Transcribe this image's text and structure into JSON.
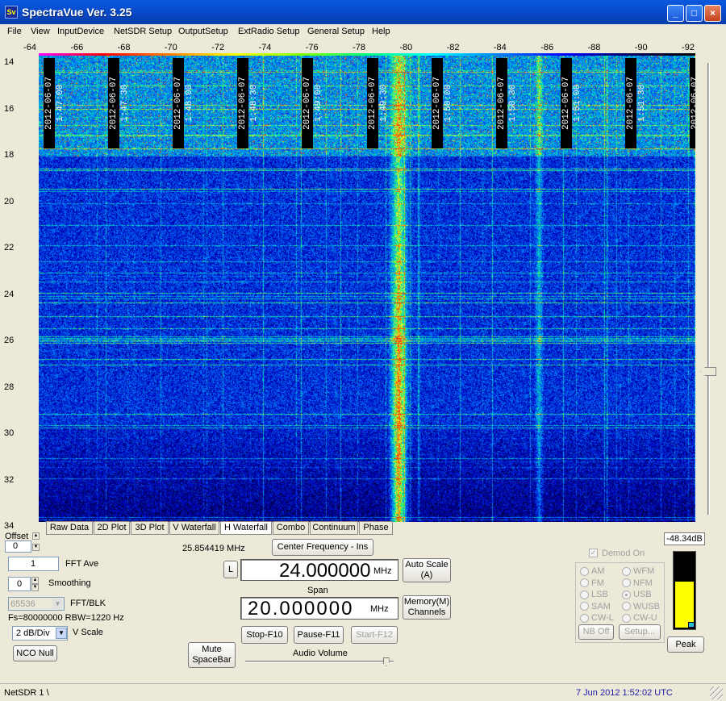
{
  "window": {
    "icon_text": "Sv",
    "title": "SpectraVue Ver. 3.25",
    "controls": {
      "minimize": "_",
      "maximize": "□",
      "close": "×"
    }
  },
  "menu": [
    "File",
    "View",
    "InputDevice",
    "NetSDR Setup",
    "OutputSetup",
    "ExtRadio Setup",
    "General Setup",
    "Help"
  ],
  "x_scale": [
    "-64",
    "-66",
    "-68",
    "-70",
    "-72",
    "-74",
    "-76",
    "-78",
    "-80",
    "-82",
    "-84",
    "-86",
    "-88",
    "-90",
    "-92"
  ],
  "y_scale": [
    "14",
    "16",
    "18",
    "20",
    "22",
    "24",
    "26",
    "28",
    "30",
    "32",
    "34"
  ],
  "waterfall": {
    "timestamps": [
      "2012-06-07 1:47:00",
      "2012-06-07 1:47:30",
      "2012-06-07 1:48:00",
      "2012-06-07 1:48:30",
      "2012-06-07 1:49:00",
      "2012-06-07 1:49:30",
      "2012-06-07 1:50:00",
      "2012-06-07 1:50:30",
      "2012-06-07 1:51:00",
      "2012-06-07 1:51:30",
      "2012-06-07 1:52:00"
    ]
  },
  "display_tabs": [
    {
      "label": "Raw Data",
      "active": false
    },
    {
      "label": "2D Plot",
      "active": false
    },
    {
      "label": "3D Plot",
      "active": false
    },
    {
      "label": "V Waterfall",
      "active": false
    },
    {
      "label": "H Waterfall",
      "active": true
    },
    {
      "label": "Combo",
      "active": false
    },
    {
      "label": "Continuum",
      "active": false
    },
    {
      "label": "Phase",
      "active": false
    }
  ],
  "controls": {
    "offset_label": "Offset",
    "offset_value": "0",
    "fft_ave_value": "1",
    "fft_ave_label": "FFT Ave",
    "smoothing_value": "0",
    "smoothing_label": "Smoothing",
    "fft_blk_value": "65536",
    "fft_blk_label": "FFT/BLK",
    "fs_rbw": "Fs=80000000 RBW=1220 Hz",
    "vscale_value": "2 dB/Div",
    "vscale_label": "V Scale",
    "nco_null": "NCO Null",
    "mute_line1": "Mute",
    "mute_line2": "SpaceBar",
    "cursor_freq": "25.854419 MHz",
    "center_freq_button": "Center Frequency - Ins",
    "lock_button": "L",
    "center_freq_value": "24.000000",
    "center_freq_unit": "MHz",
    "span_label": "Span",
    "span_value": "20.000000",
    "span_unit": "MHz",
    "auto_scale_line1": "Auto Scale",
    "auto_scale_line2": "(A)",
    "memory_line1": "Memory(M)",
    "memory_line2": "Channels",
    "stop": "Stop-F10",
    "pause": "Pause-F11",
    "start": "Start-F12",
    "audio_volume_label": "Audio Volume",
    "audio_volume_level": 0.97
  },
  "demod": {
    "enabled_label": "Demod On",
    "modes": [
      {
        "label": "AM",
        "selected": false
      },
      {
        "label": "WFM",
        "selected": false
      },
      {
        "label": "FM",
        "selected": false
      },
      {
        "label": "NFM",
        "selected": false
      },
      {
        "label": "LSB",
        "selected": false
      },
      {
        "label": "USB",
        "selected": true
      },
      {
        "label": "SAM",
        "selected": false
      },
      {
        "label": "WUSB",
        "selected": false
      },
      {
        "label": "CW-L",
        "selected": false
      },
      {
        "label": "CW-U",
        "selected": false
      }
    ],
    "nb_off": "NB Off",
    "setup": "Setup..."
  },
  "meter": {
    "reading": "-48.34dB",
    "peak_button": "Peak",
    "level": 0.62,
    "colors": {
      "fill": "#ffff00",
      "background": "#000000"
    }
  },
  "status": {
    "left": "NetSDR 1  \\",
    "right": "7 Jun 2012   1:52:02 UTC"
  }
}
